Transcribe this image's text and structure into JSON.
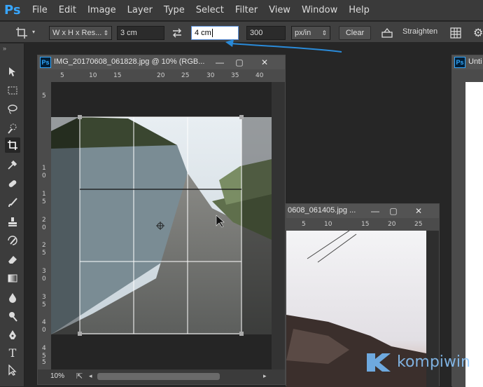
{
  "menu": {
    "app_logo": "Ps",
    "items": [
      "File",
      "Edit",
      "Image",
      "Layer",
      "Type",
      "Select",
      "Filter",
      "View",
      "Window",
      "Help"
    ]
  },
  "options": {
    "ratio_select": "W x H x Res...",
    "width_value": "3 cm",
    "height_value": "4 cm",
    "resolution_value": "300",
    "units_select": "px/in",
    "clear_label": "Clear",
    "straighten_label": "Straighten"
  },
  "doc1": {
    "ps_badge": "Ps",
    "title": "IMG_20170608_061828.jpg @ 10% (RGB...",
    "zoom": "10%",
    "ruler_top": [
      "5",
      "10",
      "15",
      "20",
      "25",
      "30",
      "35",
      "40"
    ],
    "ruler_left": [
      "5",
      "1\n0",
      "1\n5",
      "2\n0",
      "2\n5",
      "3\n0",
      "3\n5",
      "4\n0",
      "4\n5",
      "5"
    ]
  },
  "doc2": {
    "title": "0608_061405.jpg ...",
    "ruler_top": [
      "5",
      "10",
      "15",
      "20",
      "25"
    ]
  },
  "doc3": {
    "ps_badge": "Ps",
    "title": "Unti"
  },
  "watermark": "kompiwin",
  "colors": {
    "accent": "#31a8ff",
    "arrow": "#2a8ad8"
  }
}
